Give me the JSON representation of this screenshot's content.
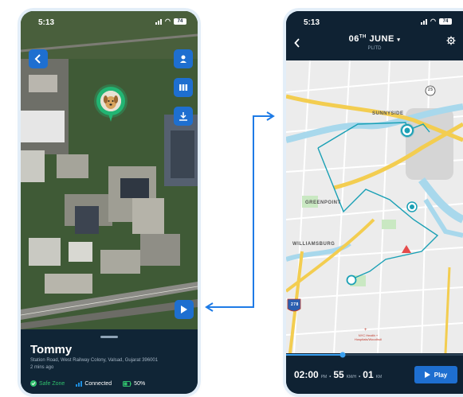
{
  "left_phone": {
    "status": {
      "time": "5:13",
      "battery": "74"
    },
    "pet": {
      "name": "Tommy",
      "address": "Station Road, West Railway Colony, Valsad, Gujarat 396001",
      "updated": "2 mins ago"
    },
    "stats": {
      "safe_zone": "Safe Zone",
      "connection": "Connected",
      "battery": "50%"
    }
  },
  "right_phone": {
    "status": {
      "time": "5:13",
      "battery": "74"
    },
    "header": {
      "day": "06",
      "suffix": "TH",
      "month": "JUNE",
      "subtitle": "PLITD"
    },
    "map_labels": {
      "sunnyside": "SUNNYSIDE",
      "greenpoint": "GREENPOINT",
      "williamsburg": "WILLIAMSBURG",
      "hospital": "NYC Health + Hospitals/Woodhull",
      "route_25": "25",
      "interstate": "278"
    },
    "playback": {
      "progress": 0.32,
      "time": "02:00",
      "meridiem": "PM",
      "speed": "55",
      "speed_unit": "KM/H",
      "distance": "01",
      "distance_unit": "KM",
      "play_label": "Play"
    }
  },
  "colors": {
    "accent": "#1e6fd0",
    "route": "#1aa0b5",
    "safe": "#2fbf6c",
    "panel": "#0f2233"
  }
}
